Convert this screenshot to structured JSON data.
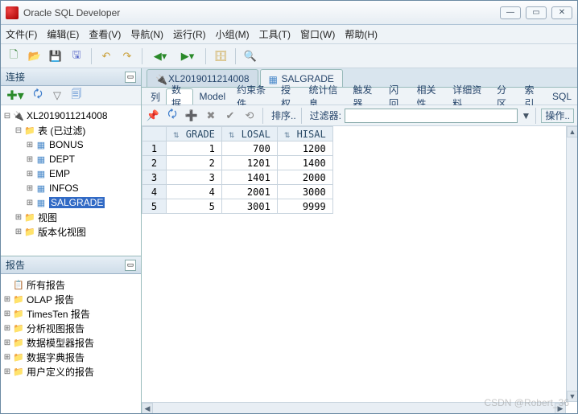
{
  "window": {
    "title": "Oracle SQL Developer"
  },
  "menu": {
    "file": "文件(F)",
    "edit": "编辑(E)",
    "view": "查看(V)",
    "navigate": "导航(N)",
    "run": "运行(R)",
    "team": "小组(M)",
    "tools": "工具(T)",
    "window": "窗口(W)",
    "help": "帮助(H)"
  },
  "panels": {
    "connections": "连接",
    "reports": "报告"
  },
  "connTree": {
    "root": "XL2019011214008",
    "tablesNode": "表 (已过滤)",
    "tables": [
      "BONUS",
      "DEPT",
      "EMP",
      "INFOS",
      "SALGRADE"
    ],
    "views": "视图",
    "verViews": "版本化视图"
  },
  "reportsTree": {
    "root": "所有报告",
    "items": [
      "OLAP 报告",
      "TimesTen 报告",
      "分析视图报告",
      "数据模型器报告",
      "数据字典报告",
      "用户定义的报告"
    ]
  },
  "docTabs": {
    "tab1": "XL2019011214008",
    "tab2": "SALGRADE"
  },
  "subTabs": {
    "cols": "列",
    "data": "数据",
    "model": "Model",
    "constraints": "约束条件",
    "grants": "授权",
    "stats": "统计信息",
    "triggers": "触发器",
    "flash": "闪回",
    "deps": "相关性",
    "details": "详细资料",
    "parts": "分区",
    "idx": "索引",
    "sql": "SQL"
  },
  "gridToolbar": {
    "sort": "排序..",
    "filter": "过滤器:",
    "actions": "操作.."
  },
  "grid": {
    "cols": [
      "GRADE",
      "LOSAL",
      "HISAL"
    ],
    "rows": [
      [
        1,
        700,
        1200
      ],
      [
        2,
        1201,
        1400
      ],
      [
        3,
        1401,
        2000
      ],
      [
        4,
        2001,
        3000
      ],
      [
        5,
        3001,
        9999
      ]
    ]
  },
  "watermark": "CSDN @Robert_36"
}
